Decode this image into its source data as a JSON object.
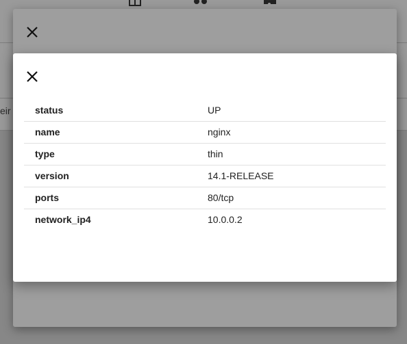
{
  "background": {
    "partial_text": "eir in",
    "nav_icons": [
      "dashboard-icon",
      "dots-icon",
      "puzzle-icon"
    ]
  },
  "outer_dialog": {
    "close_icon": "close-icon"
  },
  "inner_dialog": {
    "close_icon": "close-icon",
    "rows": [
      {
        "key": "status",
        "value": "UP"
      },
      {
        "key": "name",
        "value": "nginx"
      },
      {
        "key": "type",
        "value": "thin"
      },
      {
        "key": "version",
        "value": "14.1-RELEASE"
      },
      {
        "key": "ports",
        "value": "80/tcp"
      },
      {
        "key": "network_ip4",
        "value": "10.0.0.2"
      }
    ]
  },
  "colors": {
    "overlay": "#878787",
    "dialog_bg": "#ffffff",
    "divider": "#e0e0e0",
    "text": "#212121"
  }
}
